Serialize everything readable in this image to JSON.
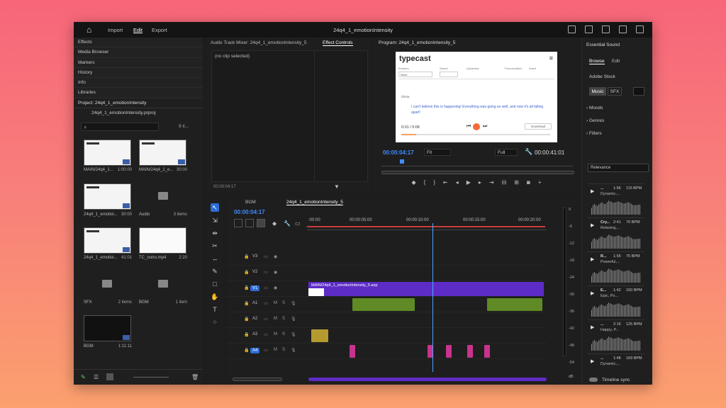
{
  "window": {
    "title": "24q4_1_emotionIntensity"
  },
  "menu": {
    "import": "Import",
    "edit": "Edit",
    "export": "Export"
  },
  "left_panels": [
    "Effects",
    "Media Browser",
    "Markers",
    "History",
    "Info",
    "Libraries"
  ],
  "project": {
    "title": "Project: 24q4_1_emotionIntensity",
    "file": "24q4_1_emotionIntensity.prproj",
    "item_count": "9 it...",
    "items": [
      {
        "name": "MAIN/24q4_1...",
        "value": "1:00:00"
      },
      {
        "name": "MAIN/24q4_1_e...",
        "value": "30:00"
      },
      {
        "name": "24q4_1_emotioi...",
        "value": "30:00"
      },
      {
        "name": "Audio",
        "value": "3 items"
      },
      {
        "name": "24q4_1_emotioi...",
        "value": "41:01"
      },
      {
        "name": "TC_outro.mp4",
        "value": "2:20"
      },
      {
        "name": "SFX",
        "value": "2 items"
      },
      {
        "name": "BGM",
        "value": "1 item"
      },
      {
        "name": "BGM",
        "value": "1:11:11"
      }
    ]
  },
  "mixer": {
    "tab1": "Audio Track Mixer: 24q4_1_emotionIntensity_5",
    "tab2": "Effect Controls",
    "no_clip": "(no clip selected)",
    "timecode": "00:00:04:17"
  },
  "program": {
    "title": "Program: 24q4_1_emotionIntensity_5",
    "timecode": "00:00:04:17",
    "fit": "Fit",
    "full": "Full",
    "duration": "00:00:41:01",
    "video": {
      "logo": "typecast",
      "labels": [
        "Emotion",
        "Speed",
        "Dynamics",
        "Pronunciation",
        "Insert"
      ],
      "emotion_value": "None",
      "speaker": "Olivia",
      "text": "I can't believe this is happening! Everything was going so well, and now it's all falling apart!",
      "time": "0:01 / 0:06",
      "download": "Download"
    }
  },
  "timeline": {
    "tab_bgm": "BGM",
    "tab_seq": "24q4_1_emotionIntensity_5",
    "timecode": "00:00:04:17",
    "ticks": [
      ":00:00",
      "00:00:05:00",
      "00:00:10:00",
      "00:00:15:00",
      "00:00:20:00"
    ],
    "tracks": [
      "V3",
      "V2",
      "V1",
      "A1",
      "A2",
      "A3",
      "A4"
    ],
    "clip_video": "MAIN/24q4_1_emotionIntensity_5.aep"
  },
  "meter": {
    "labels": [
      "0",
      "-6",
      "-12",
      "-18",
      "-24",
      "-30",
      "-36",
      "-42",
      "-48",
      "-54",
      "dB"
    ]
  },
  "essential_sound": {
    "title": "Essential Sound",
    "tab_browse": "Browse",
    "tab_edit": "Edit",
    "stock": "Adobe Stock",
    "music": "Music",
    "sfx": "SFX",
    "categories": [
      "Moods",
      "Genres",
      "Filters"
    ],
    "sort": "Relevance",
    "tracks": [
      {
        "name": "...",
        "duration": "1:56",
        "bpm": "115 BPM",
        "tags": "Dynamic,..."
      },
      {
        "name": "Cry...",
        "duration": "2:41",
        "bpm": "70 BPM",
        "tags": "Relaxing,..."
      },
      {
        "name": "R...",
        "duration": "1:55",
        "bpm": "75 BPM",
        "tags": "Powerful,..."
      },
      {
        "name": "E...",
        "duration": "1:42",
        "bpm": "150 BPM",
        "tags": "Epic, Po..."
      },
      {
        "name": "...",
        "duration": "2:16",
        "bpm": "125 BPM",
        "tags": "Happy, P..."
      },
      {
        "name": "...",
        "duration": "1:48",
        "bpm": "169 BPM",
        "tags": "Dynamic,..."
      }
    ],
    "timeline_sync": "Timeline sync"
  }
}
